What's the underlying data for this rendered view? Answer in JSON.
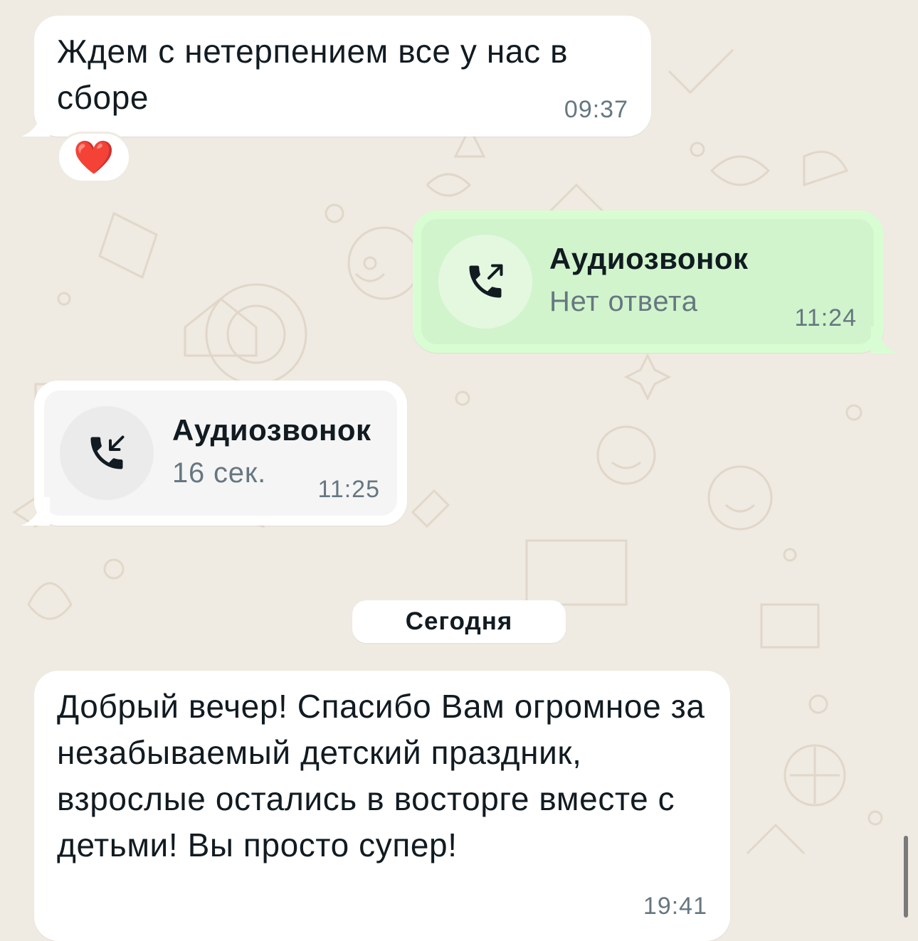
{
  "messages": {
    "m1": {
      "text": "Ждем с нетерпением все у нас в сборе",
      "time": "09:37",
      "reaction": "❤️"
    },
    "call_out": {
      "title": "Аудиозвонок",
      "status": "Нет ответа",
      "time": "11:24",
      "icon": "outgoing-call-icon"
    },
    "call_in": {
      "title": "Аудиозвонок",
      "duration": "16 сек.",
      "time": "11:25",
      "icon": "incoming-call-icon"
    },
    "date_divider": "Сегодня",
    "m2": {
      "text": "Добрый вечер! Спасибо Вам огромное за незабываемый детский праздник, взрослые остались в восторге вместе с детьми! Вы просто супер!",
      "time": "19:41"
    }
  },
  "colors": {
    "background": "#efeae2",
    "incoming_bubble": "#ffffff",
    "outgoing_bubble": "#d9fdd3",
    "outgoing_card": "#d1f4cc",
    "incoming_card": "#f5f5f5"
  }
}
